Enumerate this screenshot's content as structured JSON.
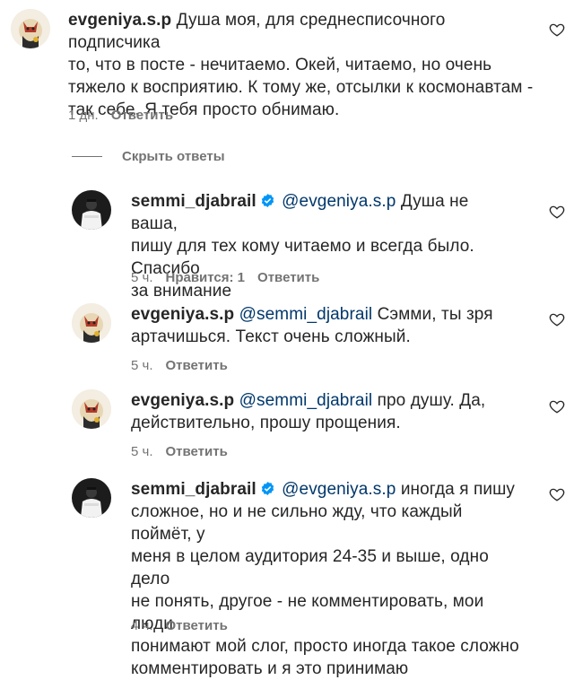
{
  "comments": [
    {
      "username": "evgeniya.s.p",
      "verified": false,
      "mention": "",
      "lines": [
        "Душа моя, для среднесписочного подписчика",
        "то, что в посте - нечитаемо. Окей, читаемо, но очень",
        "тяжело к восприятию. К тому же, отсылки к космонавтам -",
        "так себе. Я тебя просто обнимаю."
      ],
      "time": "1 дн.",
      "likes": "",
      "reply_label": "Ответить"
    },
    {
      "username": "semmi_djabrail",
      "verified": true,
      "mention": "@evgeniya.s.p",
      "lines": [
        "Душа не ваша,",
        "пишу для тех кому читаемо и всегда было. Спасибо",
        "за внимание"
      ],
      "time": "5 ч.",
      "likes": "Нравится: 1",
      "reply_label": "Ответить"
    },
    {
      "username": "evgeniya.s.p",
      "verified": false,
      "mention": "@semmi_djabrail",
      "lines": [
        "Сэмми, ты зря",
        "артачишься. Текст очень сложный."
      ],
      "time": "5 ч.",
      "likes": "",
      "reply_label": "Ответить"
    },
    {
      "username": "evgeniya.s.p",
      "verified": false,
      "mention": "@semmi_djabrail",
      "lines": [
        "про душу. Да,",
        "действительно, прошу прощения."
      ],
      "time": "5 ч.",
      "likes": "",
      "reply_label": "Ответить"
    },
    {
      "username": "semmi_djabrail",
      "verified": true,
      "mention": "@evgeniya.s.p",
      "lines": [
        "иногда я пишу",
        "сложное, но и не сильно жду, что каждый поймёт, у",
        "меня в целом аудитория 24-35 и выше, одно дело",
        "не понять, другое - не комментировать, мои люди",
        "понимают мой слог, просто иногда такое сложно",
        "комментировать и я это принимаю"
      ],
      "time": "4 ч.",
      "likes": "",
      "reply_label": "Ответить"
    }
  ],
  "hide_replies_label": "Скрыть ответы",
  "colors": {
    "text": "#262626",
    "secondary": "#737373",
    "mention": "#00376b",
    "verified": "#0095f6"
  },
  "icons": {
    "like": "heart-outline-icon",
    "verified": "verified-badge-icon"
  }
}
